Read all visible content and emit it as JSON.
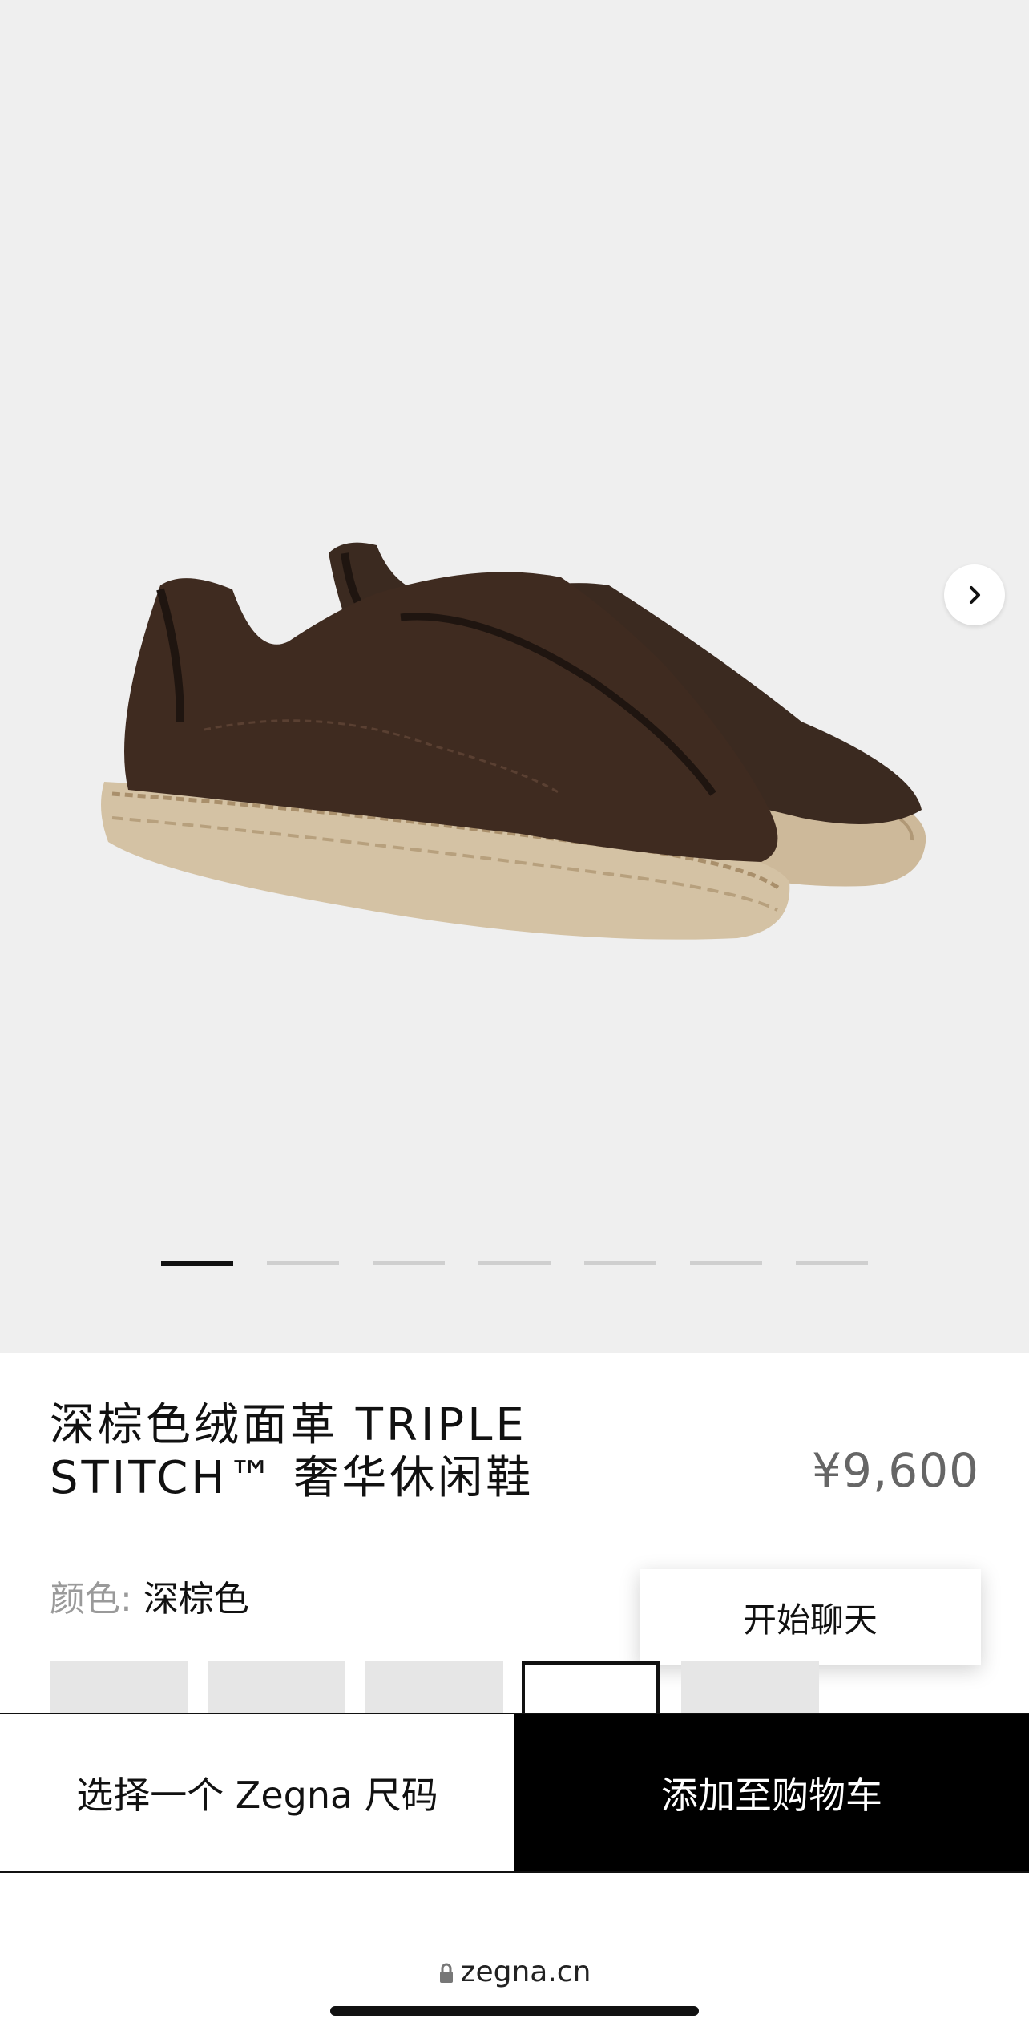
{
  "product": {
    "title_line1": "深棕色绒面革 TRIPLE",
    "title_line2": "STITCH™ 奢华休闲鞋",
    "price": "¥9,600",
    "color_label": "颜色:",
    "color_value": "深棕色"
  },
  "gallery": {
    "total_images": 7,
    "active_index": 0
  },
  "chat": {
    "label": "开始聊天"
  },
  "actions": {
    "size_label": "选择一个 Zegna 尺码",
    "cart_label": "添加至购物车"
  },
  "browser": {
    "url": "zegna.cn"
  },
  "colors": {
    "background": "#efefef",
    "shoe": "#3e2a1f",
    "sole": "#cdb99a",
    "button_dark": "#000000",
    "price": "#666666"
  }
}
